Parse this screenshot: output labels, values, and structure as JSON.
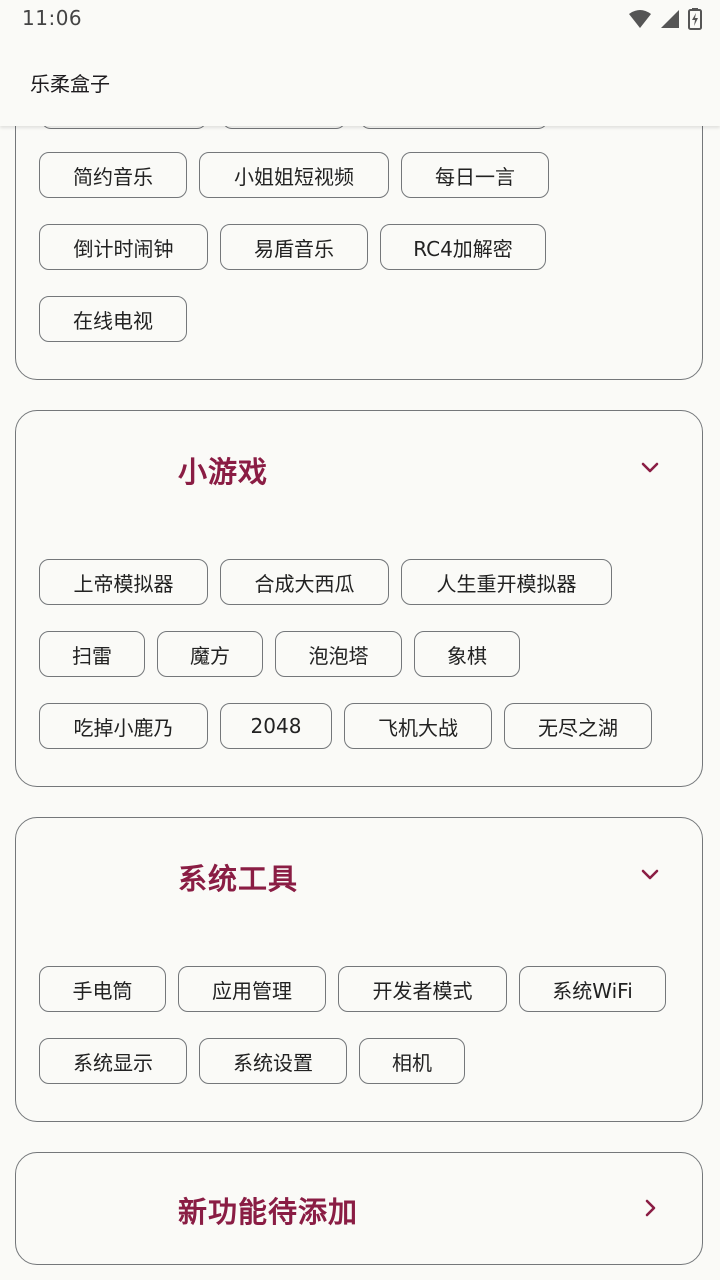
{
  "status_bar": {
    "time": "11:06"
  },
  "app_bar": {
    "title": "乐柔盒子"
  },
  "sections": {
    "top": {
      "chips": [
        "简约音乐",
        "小姐姐短视频",
        "每日一言",
        "倒计时闹钟",
        "易盾音乐",
        "RC4加解密",
        "在线电视"
      ]
    },
    "games": {
      "title": "小游戏",
      "chips": [
        "上帝模拟器",
        "合成大西瓜",
        "人生重开模拟器",
        "扫雷",
        "魔方",
        "泡泡塔",
        "象棋",
        "吃掉小鹿乃",
        "2048",
        "飞机大战",
        "无尽之湖"
      ]
    },
    "system": {
      "title": "系统工具",
      "chips": [
        "手电筒",
        "应用管理",
        "开发者模式",
        "系统WiFi",
        "系统显示",
        "系统设置",
        "相机"
      ]
    },
    "new": {
      "title": "新功能待添加"
    }
  },
  "colors": {
    "accent": "#8a1d44",
    "outline": "#74777a",
    "background": "#fafaf7"
  }
}
